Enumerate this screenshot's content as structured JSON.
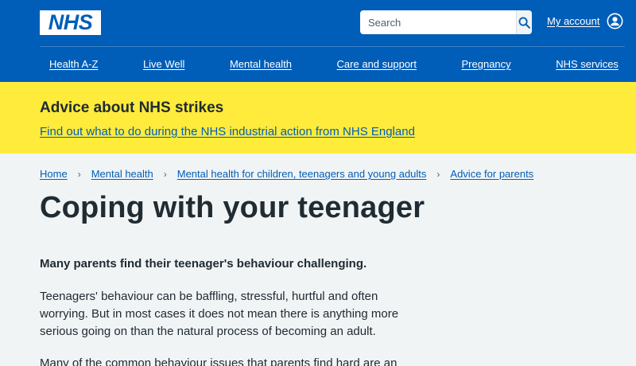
{
  "header": {
    "logo_text": "NHS",
    "search": {
      "placeholder": "Search"
    },
    "account_label": "My account"
  },
  "nav": {
    "items": [
      "Health A-Z",
      "Live Well",
      "Mental health",
      "Care and support",
      "Pregnancy",
      "NHS services"
    ]
  },
  "banner": {
    "title": "Advice about NHS strikes",
    "link": "Find out what to do during the NHS industrial action from NHS England"
  },
  "breadcrumb": {
    "items": [
      "Home",
      "Mental health",
      "Mental health for children, teenagers and young adults",
      "Advice for parents"
    ],
    "separator": "›"
  },
  "content": {
    "title": "Coping with your teenager",
    "lead": "Many parents find their teenager's behaviour challenging.",
    "paragraphs": [
      "Teenagers' behaviour can be baffling, stressful, hurtful and often worrying. But in most cases it does not mean there is anything more serious going on than the natural process of becoming an adult.",
      "Many of the common behaviour issues that parents find hard are an"
    ]
  },
  "colors": {
    "nhs_blue": "#005eb8",
    "banner_yellow": "#ffeb3b",
    "page_background": "#f0f4f5",
    "text": "#212b32"
  }
}
